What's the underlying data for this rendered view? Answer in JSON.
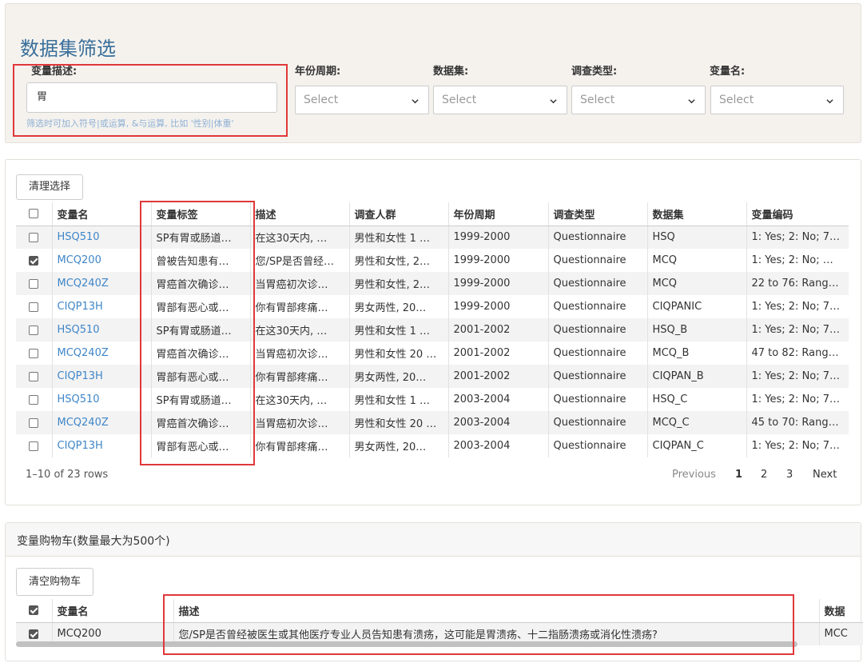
{
  "filter": {
    "title": "数据集筛选",
    "var_desc_label": "变量描述:",
    "var_desc_value": "胃",
    "help_text": "筛选时可加入符号|或运算, &与运算, 比如 '性别|体重'",
    "year_label": "年份周期:",
    "dataset_label": "数据集:",
    "survey_type_label": "调查类型:",
    "var_name_label": "变量名:",
    "select_placeholder": "Select"
  },
  "results": {
    "clear_button": "清理选择",
    "columns": [
      "变量名",
      "变量标签",
      "描述",
      "调查人群",
      "年份周期",
      "调查类型",
      "数据集",
      "变量编码"
    ],
    "rows": [
      {
        "checked": false,
        "name": "HSQ510",
        "label": "SP有胃或肠道…",
        "desc": "在这30天内, …",
        "population": "男性和女性 1 …",
        "year": "1999-2000",
        "type": "Questionnaire",
        "dataset": "HSQ",
        "code": "1: Yes; 2: No; 7…"
      },
      {
        "checked": true,
        "name": "MCQ200",
        "label": "曾被告知患有…",
        "desc": "您/SP是否曾经…",
        "population": "男性和女性, 2…",
        "year": "1999-2000",
        "type": "Questionnaire",
        "dataset": "MCQ",
        "code": "1: Yes; 2: No; …"
      },
      {
        "checked": false,
        "name": "MCQ240Z",
        "label": "胃癌首次确诊…",
        "desc": "当胃癌初次诊…",
        "population": "男性和女性, 2…",
        "year": "1999-2000",
        "type": "Questionnaire",
        "dataset": "MCQ",
        "code": "22 to 76: Rang…"
      },
      {
        "checked": false,
        "name": "CIQP13H",
        "label": "胃部有恶心或…",
        "desc": "你有胃部疼痛…",
        "population": "男女两性, 20…",
        "year": "1999-2000",
        "type": "Questionnaire",
        "dataset": "CIQPANIC",
        "code": "1: Yes; 2: No; 7…"
      },
      {
        "checked": false,
        "name": "HSQ510",
        "label": "SP有胃或肠道…",
        "desc": "在这30天内, …",
        "population": "男性和女性 1 …",
        "year": "2001-2002",
        "type": "Questionnaire",
        "dataset": "HSQ_B",
        "code": "1: Yes; 2: No; 7…"
      },
      {
        "checked": false,
        "name": "MCQ240Z",
        "label": "胃癌首次确诊…",
        "desc": "当胃癌初次诊…",
        "population": "男性和女性 20 …",
        "year": "2001-2002",
        "type": "Questionnaire",
        "dataset": "MCQ_B",
        "code": "47 to 82: Rang…"
      },
      {
        "checked": false,
        "name": "CIQP13H",
        "label": "胃部有恶心或…",
        "desc": "你有胃部疼痛…",
        "population": "男女两性, 20…",
        "year": "2001-2002",
        "type": "Questionnaire",
        "dataset": "CIQPAN_B",
        "code": "1: Yes; 2: No; 7…"
      },
      {
        "checked": false,
        "name": "HSQ510",
        "label": "SP有胃或肠道…",
        "desc": "在这30天内, …",
        "population": "男性和女性 1 …",
        "year": "2003-2004",
        "type": "Questionnaire",
        "dataset": "HSQ_C",
        "code": "1: Yes; 2: No; 7…"
      },
      {
        "checked": false,
        "name": "MCQ240Z",
        "label": "胃癌首次确诊…",
        "desc": "当胃癌初次诊…",
        "population": "男性和女性 20 …",
        "year": "2003-2004",
        "type": "Questionnaire",
        "dataset": "MCQ_C",
        "code": "45 to 70: Rang…"
      },
      {
        "checked": false,
        "name": "CIQP13H",
        "label": "胃部有恶心或…",
        "desc": "你有胃部疼痛…",
        "population": "男女两性, 20…",
        "year": "2003-2004",
        "type": "Questionnaire",
        "dataset": "CIQPAN_C",
        "code": "1: Yes; 2: No; 7…"
      }
    ],
    "page_info": "1–10 of 23 rows",
    "pagination": {
      "previous": "Previous",
      "pages": [
        "1",
        "2",
        "3"
      ],
      "next": "Next",
      "current": "1"
    }
  },
  "cart": {
    "title": "变量购物车(数量最大为500个)",
    "clear_button": "清空购物车",
    "columns": [
      "变量名",
      "描述",
      "数据"
    ],
    "rows": [
      {
        "checked": true,
        "name": "MCQ200",
        "desc": "您/SP是否曾经被医生或其他医疗专业人员告知患有溃疡，这可能是胃溃疡、十二指肠溃疡或消化性溃疡?",
        "dataset": "MCC"
      }
    ]
  },
  "colors": {
    "accent": "#3a6f9a",
    "link": "#3f86c8",
    "highlight": "#e0383a",
    "panel_bg": "#f5f2ee"
  }
}
